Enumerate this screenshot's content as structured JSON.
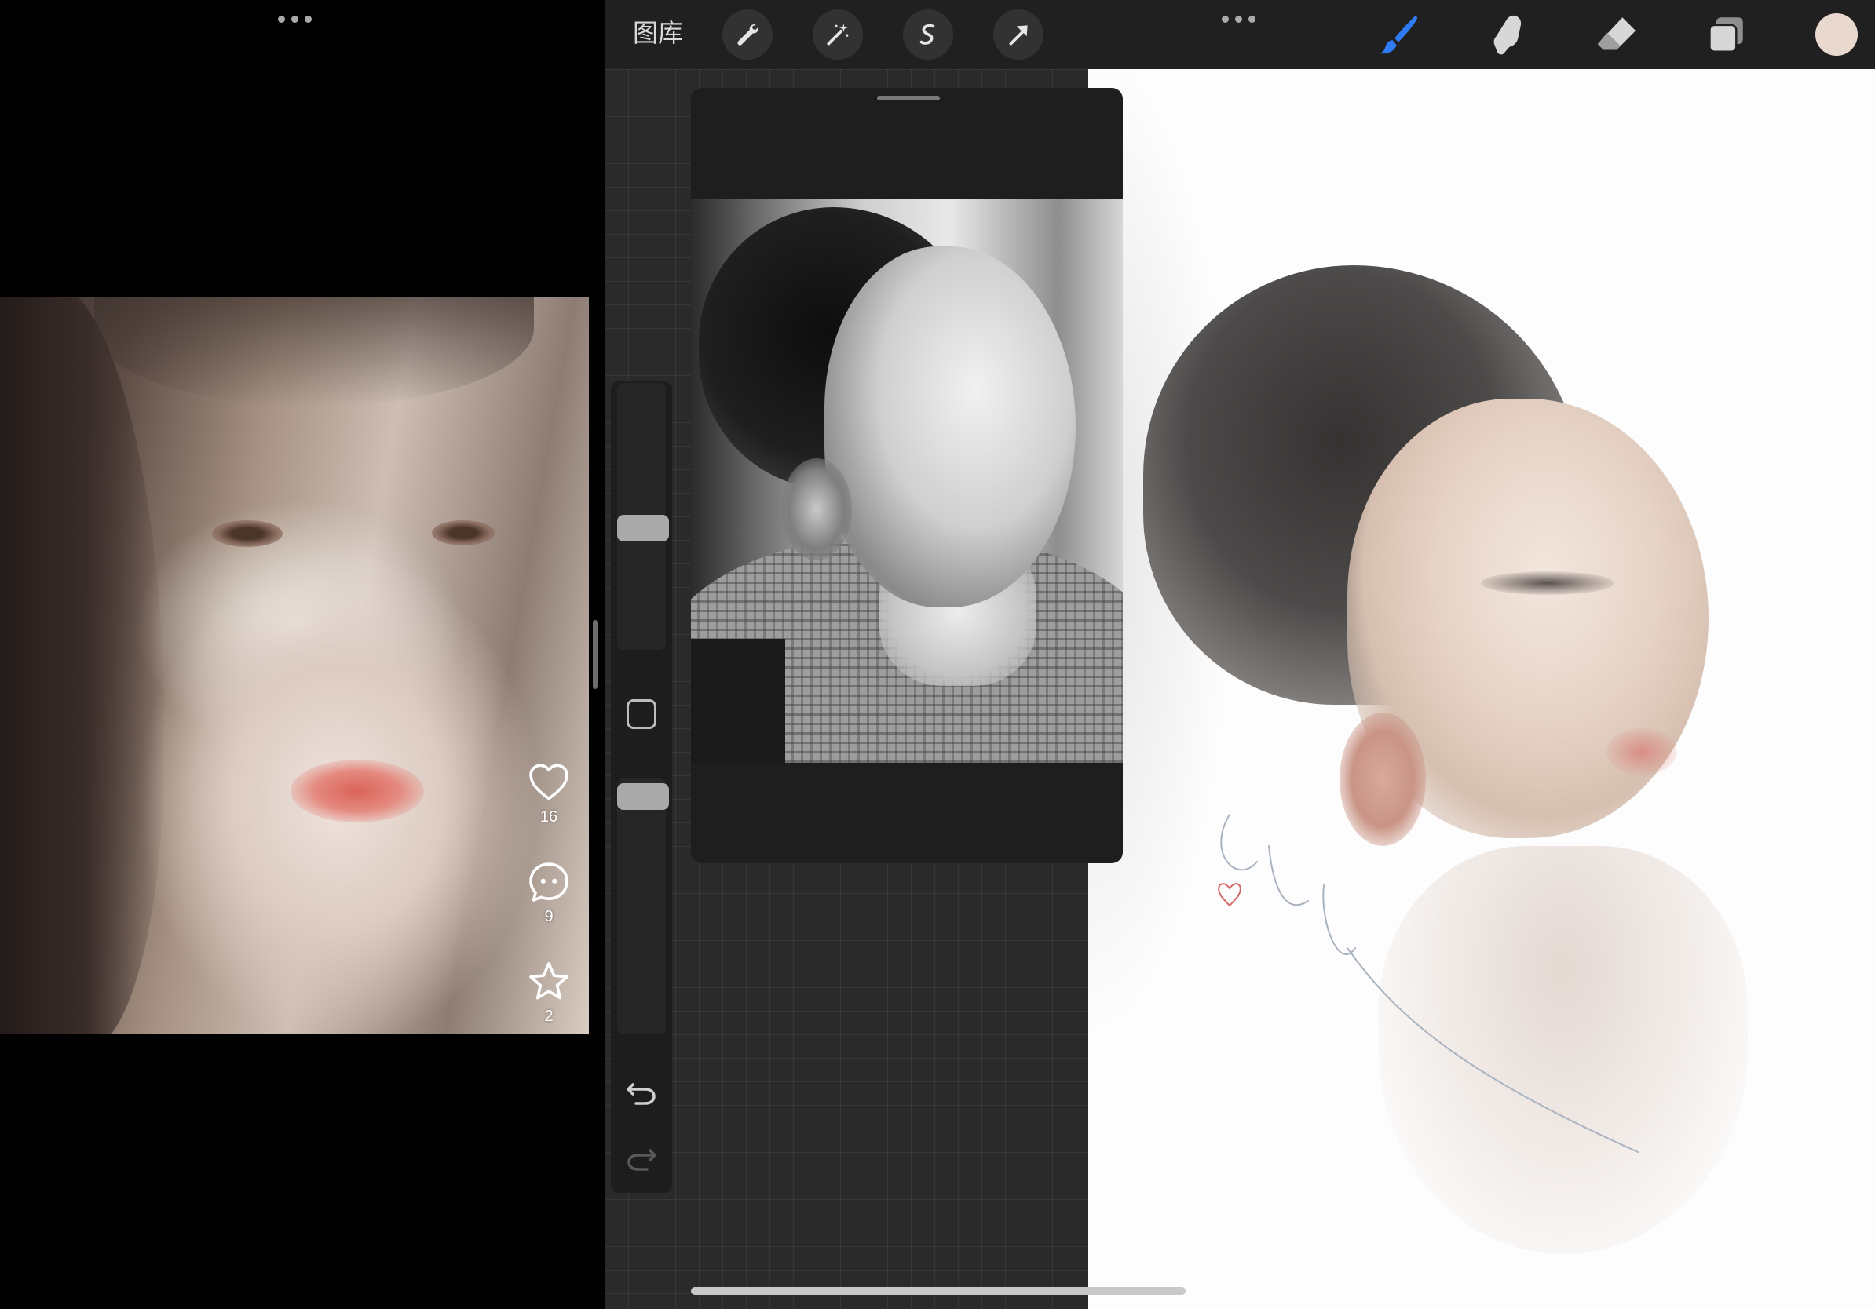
{
  "left_app": {
    "menu_icon": "more-dots-icon",
    "like": {
      "icon": "heart-icon",
      "count": "16"
    },
    "comment": {
      "icon": "comment-bubble-icon",
      "count": "9"
    },
    "favorite": {
      "icon": "star-icon",
      "count": "2"
    }
  },
  "drawing_app": {
    "toolbar": {
      "gallery_label": "图库",
      "actions_icon": "wrench-icon",
      "adjustments_icon": "magic-wand-icon",
      "selection_icon": "selection-s-icon",
      "transform_icon": "arrow-cursor-icon",
      "menu_icon": "more-dots-icon",
      "brush_icon": "brush-icon",
      "smudge_icon": "smudge-finger-icon",
      "eraser_icon": "eraser-icon",
      "layers_icon": "layers-icon"
    },
    "colors": {
      "active_tool": "#2f7bf5",
      "current_color": "#e8d8ce",
      "toolbar_bg": "#202020"
    },
    "sidebar": {
      "brush_size_fraction": 0.45,
      "brush_opacity_fraction": 0.98,
      "undo_icon": "undo-icon",
      "redo_icon": "redo-icon",
      "modify_icon": "square-modify-icon"
    }
  }
}
